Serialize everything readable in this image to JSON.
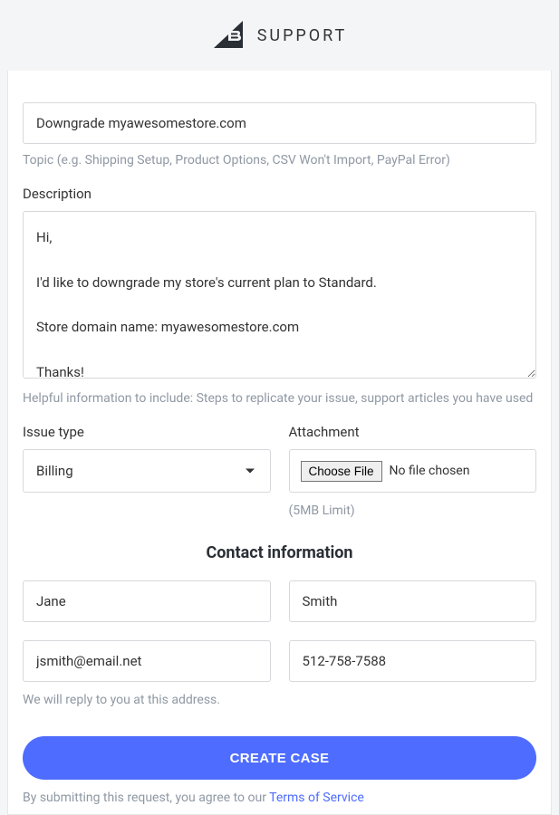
{
  "header": {
    "app_name": "SUPPORT"
  },
  "topic": {
    "value": "Downgrade myawesomestore.com",
    "helper": "Topic (e.g. Shipping Setup, Product Options, CSV Won't Import, PayPal Error)"
  },
  "description": {
    "label": "Description",
    "value": "Hi,\n\nI'd like to downgrade my store's current plan to Standard.\n\nStore domain name: myawesomestore.com\n\nThanks!",
    "helper": "Helpful information to include: Steps to replicate your issue, support articles you have used"
  },
  "issue_type": {
    "label": "Issue type",
    "selected": "Billing"
  },
  "attachment": {
    "label": "Attachment",
    "button": "Choose File",
    "status": "No file chosen",
    "limit": "(5MB Limit)"
  },
  "contact": {
    "heading": "Contact information",
    "first_name": "Jane",
    "last_name": "Smith",
    "email": "jsmith@email.net",
    "phone": "512-758-7588",
    "helper": "We will reply to you at this address."
  },
  "submit": {
    "label": "CREATE CASE"
  },
  "terms": {
    "prefix": "By submitting this request, you agree to our ",
    "link": "Terms of Service"
  }
}
